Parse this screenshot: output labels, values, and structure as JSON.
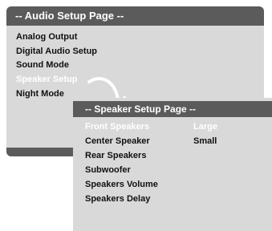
{
  "audio_setup": {
    "title": "-- Audio Setup Page --",
    "items": [
      {
        "label": "Analog Output"
      },
      {
        "label": "Digital Audio Setup"
      },
      {
        "label": "Sound Mode"
      },
      {
        "label": "Speaker Setup",
        "selected": true
      },
      {
        "label": "Night Mode"
      }
    ]
  },
  "speaker_setup": {
    "title": "-- Speaker Setup Page --",
    "rows": [
      {
        "label": "Front Speakers",
        "value": "Large",
        "selected": true
      },
      {
        "label": "Center Speaker",
        "value": "Small"
      },
      {
        "label": "Rear Speakers",
        "value": ""
      },
      {
        "label": "Subwoofer",
        "value": ""
      },
      {
        "label": "Speakers Volume",
        "value": ""
      },
      {
        "label": "Speakers Delay",
        "value": ""
      }
    ]
  },
  "colors": {
    "panel_bg": "#d9d9d9",
    "titlebar_bg": "#5b5b5b",
    "text": "#111111",
    "highlight_text": "#ffffff"
  },
  "icons": {
    "transition_arrow": "curved-arrow-icon"
  }
}
